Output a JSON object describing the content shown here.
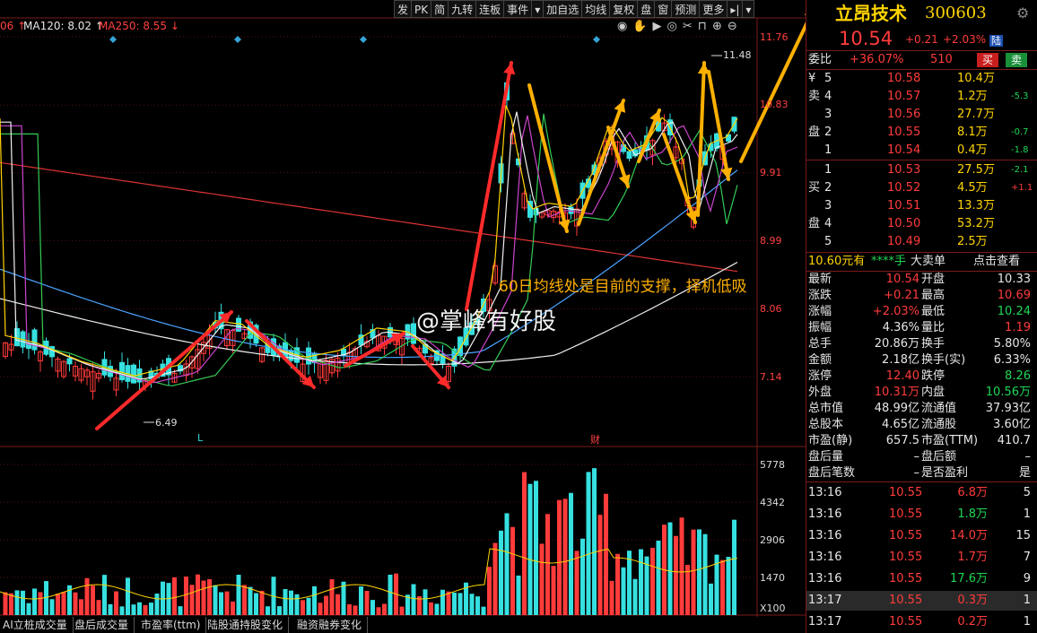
{
  "toolbar": {
    "buttons": [
      "发",
      "PK",
      "简",
      "九转",
      "连板",
      "事件",
      "▾",
      "加自选",
      "均线",
      "复权",
      "盘",
      "窗",
      "预测",
      "更多",
      "▸|",
      "▾"
    ]
  },
  "ma_labels": [
    {
      "text": "06 ↑",
      "color": "#ff4040"
    },
    {
      "text": "MA120: 8.02 ↑",
      "color": "#e6e6e6"
    },
    {
      "text": "MA250: 8.55 ↓",
      "color": "#ff4040"
    }
  ],
  "price_axis": [
    "11.76",
    "10.83",
    "9.91",
    "8.99",
    "8.06",
    "7.14"
  ],
  "volume_axis": [
    "5778",
    "4342",
    "2906",
    "1470",
    "X100"
  ],
  "chart_annotations": {
    "high_label": "11.48",
    "low_label": "6.49",
    "marker_L": "L",
    "marker_cai": "财",
    "overlay_text": "60日均线处是目前的支撑，择机低吸",
    "watermark": "@掌峰有好股"
  },
  "quote": {
    "name": "立昂技术",
    "code": "300603",
    "price": "10.54",
    "change": "+0.21",
    "change_pct": "+2.03%",
    "tag": "陆",
    "weibi_label": "委比",
    "weibi": "+36.07%",
    "weicha": "510",
    "sell_btn": "买",
    "buy_btn": "卖",
    "sell_side_label": [
      "¥",
      "卖",
      "",
      "盘",
      ""
    ],
    "buy_side_label": [
      "",
      "买",
      "",
      "盘",
      ""
    ],
    "asks": [
      {
        "lvl": "5",
        "price": "10.58",
        "vol": "10.4万",
        "chg": ""
      },
      {
        "lvl": "4",
        "price": "10.57",
        "vol": "1.2万",
        "chg": "-5.3"
      },
      {
        "lvl": "3",
        "price": "10.56",
        "vol": "27.7万",
        "chg": ""
      },
      {
        "lvl": "2",
        "price": "10.55",
        "vol": "8.1万",
        "chg": "-0.7"
      },
      {
        "lvl": "1",
        "price": "10.54",
        "vol": "0.4万",
        "chg": "-1.8"
      }
    ],
    "bids": [
      {
        "lvl": "1",
        "price": "10.53",
        "vol": "27.5万",
        "chg": "-2.1"
      },
      {
        "lvl": "2",
        "price": "10.52",
        "vol": "4.5万",
        "chg": "+1.1"
      },
      {
        "lvl": "3",
        "price": "10.51",
        "vol": "13.3万",
        "chg": ""
      },
      {
        "lvl": "4",
        "price": "10.50",
        "vol": "53.2万",
        "chg": ""
      },
      {
        "lvl": "5",
        "price": "10.49",
        "vol": "2.5万",
        "chg": ""
      }
    ],
    "bigorder": {
      "a": "10.60元有",
      "b": "****手",
      "c": "大卖单",
      "d": "点击查看"
    },
    "stats": [
      {
        "l1": "最新",
        "v1": "10.54",
        "c1": "red",
        "l2": "开盘",
        "v2": "10.33",
        "c2": "white"
      },
      {
        "l1": "涨跌",
        "v1": "+0.21",
        "c1": "red",
        "l2": "最高",
        "v2": "10.69",
        "c2": "red"
      },
      {
        "l1": "涨幅",
        "v1": "+2.03%",
        "c1": "red",
        "l2": "最低",
        "v2": "10.24",
        "c2": "green"
      },
      {
        "l1": "振幅",
        "v1": "4.36%",
        "c1": "white",
        "l2": "量比",
        "v2": "1.19",
        "c2": "red"
      },
      {
        "l1": "总手",
        "v1": "20.86万",
        "c1": "white",
        "l2": "换手",
        "v2": "5.80%",
        "c2": "white"
      },
      {
        "l1": "金额",
        "v1": "2.18亿",
        "c1": "white",
        "l2": "换手(实)",
        "v2": "6.33%",
        "c2": "white"
      },
      {
        "l1": "涨停",
        "v1": "12.40",
        "c1": "red",
        "l2": "跌停",
        "v2": "8.26",
        "c2": "green"
      },
      {
        "l1": "外盘",
        "v1": "10.31万",
        "c1": "red",
        "l2": "内盘",
        "v2": "10.56万",
        "c2": "green"
      },
      {
        "l1": "总市值",
        "v1": "48.99亿",
        "c1": "white",
        "l2": "流通值",
        "v2": "37.93亿",
        "c2": "white"
      },
      {
        "l1": "总股本",
        "v1": "4.65亿",
        "c1": "white",
        "l2": "流通股",
        "v2": "3.60亿",
        "c2": "white"
      },
      {
        "l1": "市盈(静)",
        "v1": "657.5",
        "c1": "white",
        "l2": "市盈(TTM)",
        "v2": "410.7",
        "c2": "white"
      },
      {
        "l1": "盘后量",
        "v1": "–",
        "c1": "white",
        "l2": "盘后额",
        "v2": "–",
        "c2": "white"
      },
      {
        "l1": "盘后笔数",
        "v1": "–",
        "c1": "white",
        "l2": "是否盈利",
        "v2": "是",
        "c2": "white"
      }
    ],
    "ticks": [
      {
        "t": "13:16",
        "p": "10.55",
        "v": "6.8万",
        "vc": "red",
        "n": "5"
      },
      {
        "t": "13:16",
        "p": "10.55",
        "v": "1.8万",
        "vc": "green",
        "n": "1"
      },
      {
        "t": "13:16",
        "p": "10.55",
        "v": "14.0万",
        "vc": "red",
        "n": "15"
      },
      {
        "t": "13:16",
        "p": "10.55",
        "v": "1.7万",
        "vc": "red",
        "n": "7"
      },
      {
        "t": "13:16",
        "p": "10.55",
        "v": "17.6万",
        "vc": "green",
        "n": "9"
      },
      {
        "t": "13:17",
        "p": "10.55",
        "v": "0.3万",
        "vc": "red",
        "n": "1"
      },
      {
        "t": "13:17",
        "p": "10.55",
        "v": "0.2万",
        "vc": "red",
        "n": "1"
      }
    ]
  },
  "bottom_tabs": [
    "AI立桩成交量",
    "盘后成交量",
    "市盈率(ttm)",
    "陆股通持股变化",
    "融资融券变化"
  ],
  "chart_data": {
    "type": "candlestick",
    "price_axis_ticks": [
      11.76,
      10.83,
      9.91,
      8.99,
      8.06,
      7.14
    ],
    "volume_axis_ticks": [
      5778,
      4342,
      2906,
      1470
    ],
    "high": 11.48,
    "low": 6.49,
    "ma120": 8.02,
    "ma250": 8.55
  }
}
